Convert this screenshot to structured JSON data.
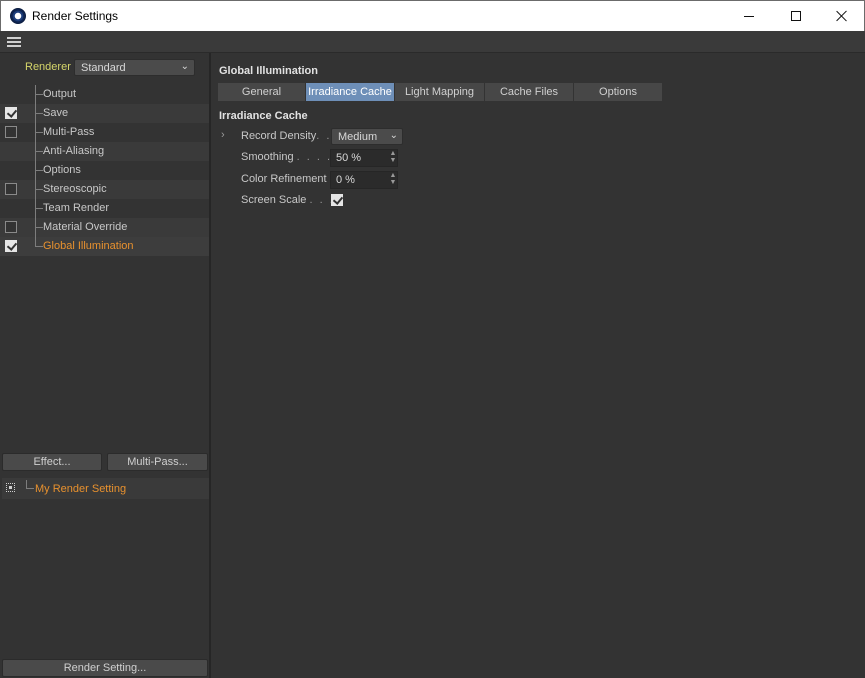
{
  "window": {
    "title": "Render Settings"
  },
  "sidebar": {
    "renderer_label": "Renderer",
    "renderer_value": "Standard",
    "items": [
      {
        "label": "Output",
        "checkbox": "none"
      },
      {
        "label": "Save",
        "checkbox": "checked"
      },
      {
        "label": "Multi-Pass",
        "checkbox": "unchecked"
      },
      {
        "label": "Anti-Aliasing",
        "checkbox": "none"
      },
      {
        "label": "Options",
        "checkbox": "none"
      },
      {
        "label": "Stereoscopic",
        "checkbox": "unchecked"
      },
      {
        "label": "Team Render",
        "checkbox": "none"
      },
      {
        "label": "Material Override",
        "checkbox": "unchecked"
      },
      {
        "label": "Global Illumination",
        "checkbox": "checked",
        "selected": true
      }
    ],
    "effect_button": "Effect...",
    "multipass_button": "Multi-Pass...",
    "render_setting_item": "My Render Setting",
    "render_setting_button": "Render Setting..."
  },
  "main": {
    "section_title": "Global Illumination",
    "tabs": [
      {
        "label": "General"
      },
      {
        "label": "Irradiance Cache",
        "active": true
      },
      {
        "label": "Light Mapping"
      },
      {
        "label": "Cache Files"
      },
      {
        "label": "Options"
      }
    ],
    "group_title": "Irradiance Cache",
    "record_density": {
      "label": "Record Density",
      "dots": ". .",
      "value": "Medium"
    },
    "smoothing": {
      "label": "Smoothing",
      "dots": ". . . .",
      "value": "50 %"
    },
    "color_refinement": {
      "label": "Color Refinement",
      "value": "0 %"
    },
    "screen_scale": {
      "label": "Screen Scale",
      "dots": ". . .",
      "checked": true
    }
  },
  "colors": {
    "accent_orange": "#e8912e",
    "tab_active": "#6e8fb8",
    "renderer_label": "#d6d66a"
  },
  "icons": [
    "app-icon",
    "hamburger-icon",
    "minimize-icon",
    "maximize-icon",
    "close-icon"
  ]
}
